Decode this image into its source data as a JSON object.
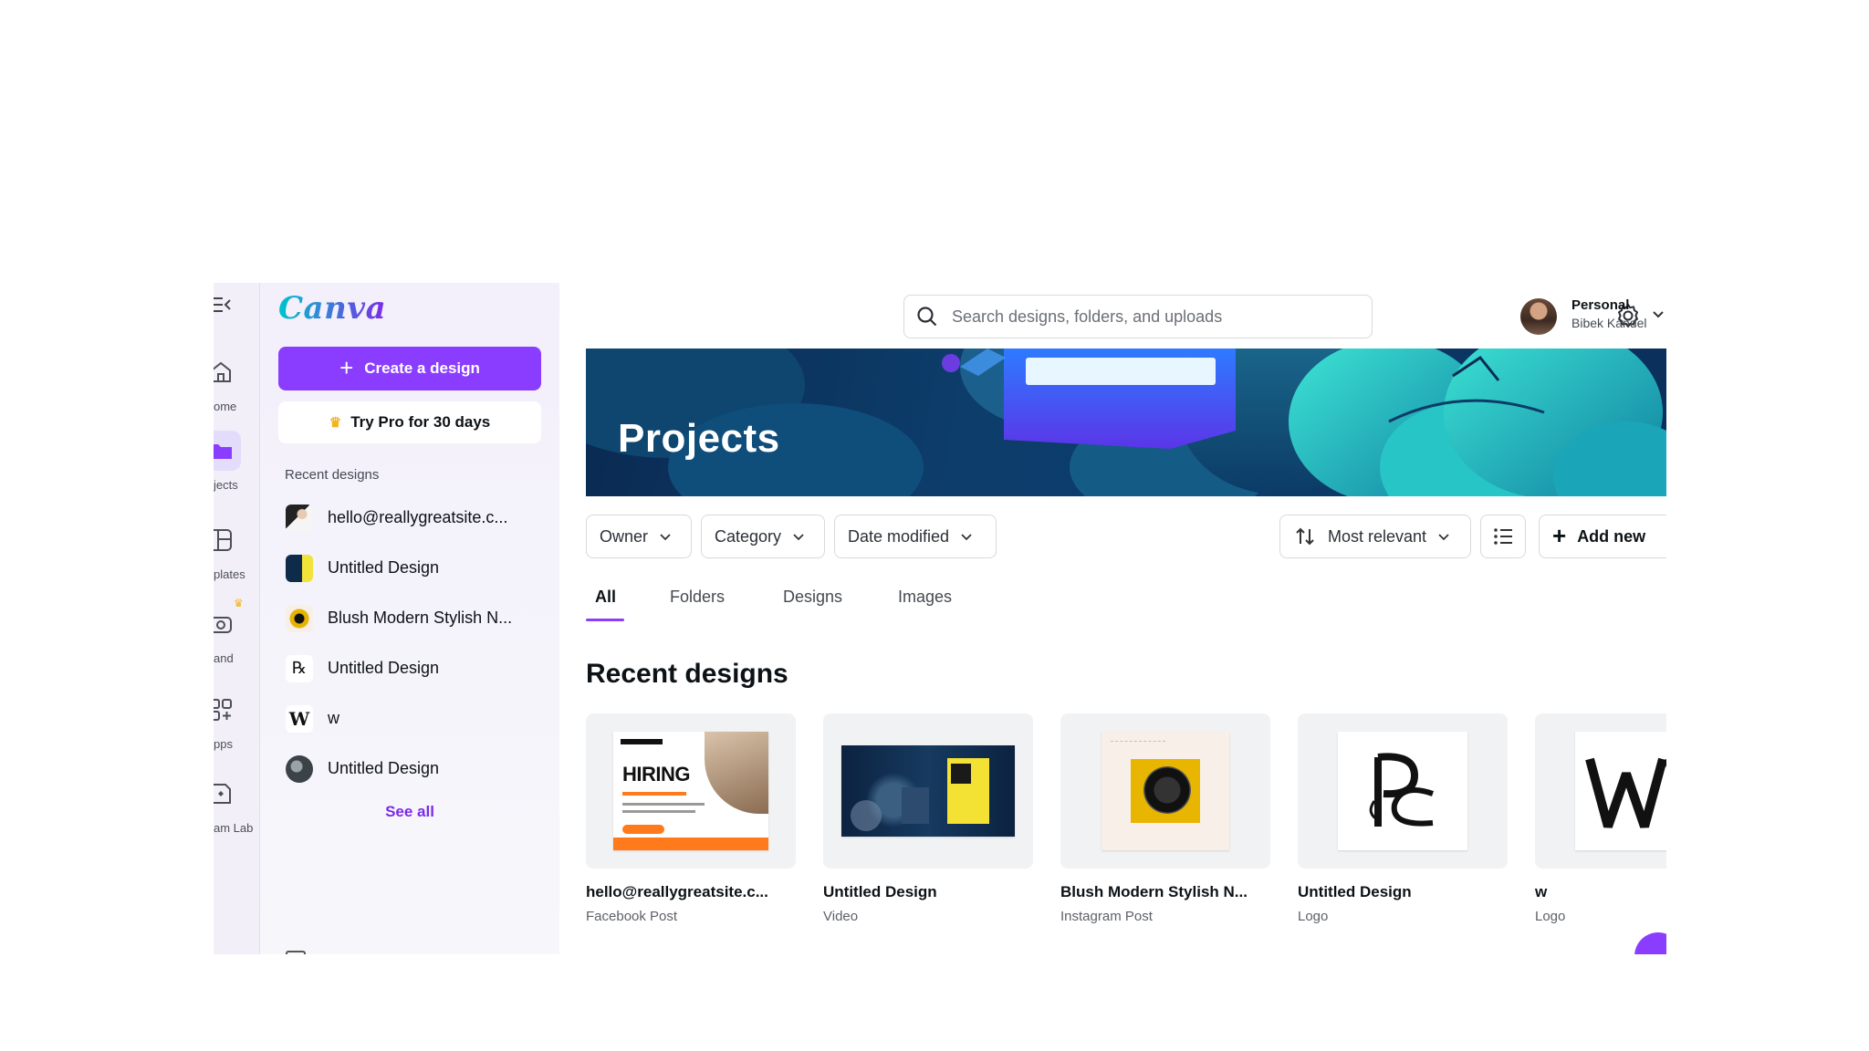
{
  "rail": {
    "items": [
      {
        "label": "ome",
        "icon": "home-icon"
      },
      {
        "label": "jects",
        "icon": "folder-icon"
      },
      {
        "label": "plates",
        "icon": "templates-icon"
      },
      {
        "label": "and",
        "icon": "brand-icon"
      },
      {
        "label": "pps",
        "icon": "apps-icon"
      },
      {
        "label": "am Lab",
        "icon": "dream-lab-icon"
      }
    ]
  },
  "panel": {
    "logo": "Canva",
    "create_label": "Create a design",
    "pro_label": "Try Pro for 30 days",
    "recent_heading": "Recent designs",
    "recent_items": [
      {
        "name": "hello@reallygreatsite.c..."
      },
      {
        "name": "Untitled Design"
      },
      {
        "name": "Blush Modern Stylish N..."
      },
      {
        "name": "Untitled Design"
      },
      {
        "name": "w"
      },
      {
        "name": "Untitled Design"
      }
    ],
    "see_all": "See all"
  },
  "topbar": {
    "search_placeholder": "Search designs, folders, and uploads",
    "account_type": "Personal",
    "account_name": "Bibek Kandel"
  },
  "banner": {
    "title": "Projects"
  },
  "filters": {
    "owner": "Owner",
    "category": "Category",
    "date_modified": "Date modified",
    "sort": "Most relevant",
    "add_new": "Add new"
  },
  "tabs": [
    {
      "label": "All",
      "active": true
    },
    {
      "label": "Folders"
    },
    {
      "label": "Designs"
    },
    {
      "label": "Images"
    }
  ],
  "section_title": "Recent designs",
  "designs": [
    {
      "title": "hello@reallygreatsite.c...",
      "type": "Facebook Post",
      "thumb_text": "HIRING"
    },
    {
      "title": "Untitled Design",
      "type": "Video"
    },
    {
      "title": "Blush Modern Stylish N...",
      "type": "Instagram Post"
    },
    {
      "title": "Untitled Design",
      "type": "Logo"
    },
    {
      "title": "w",
      "type": "Logo"
    }
  ],
  "colors": {
    "accent": "#8b3dff",
    "banner": "#0c3c6c",
    "teal": "#2ed3c6"
  }
}
